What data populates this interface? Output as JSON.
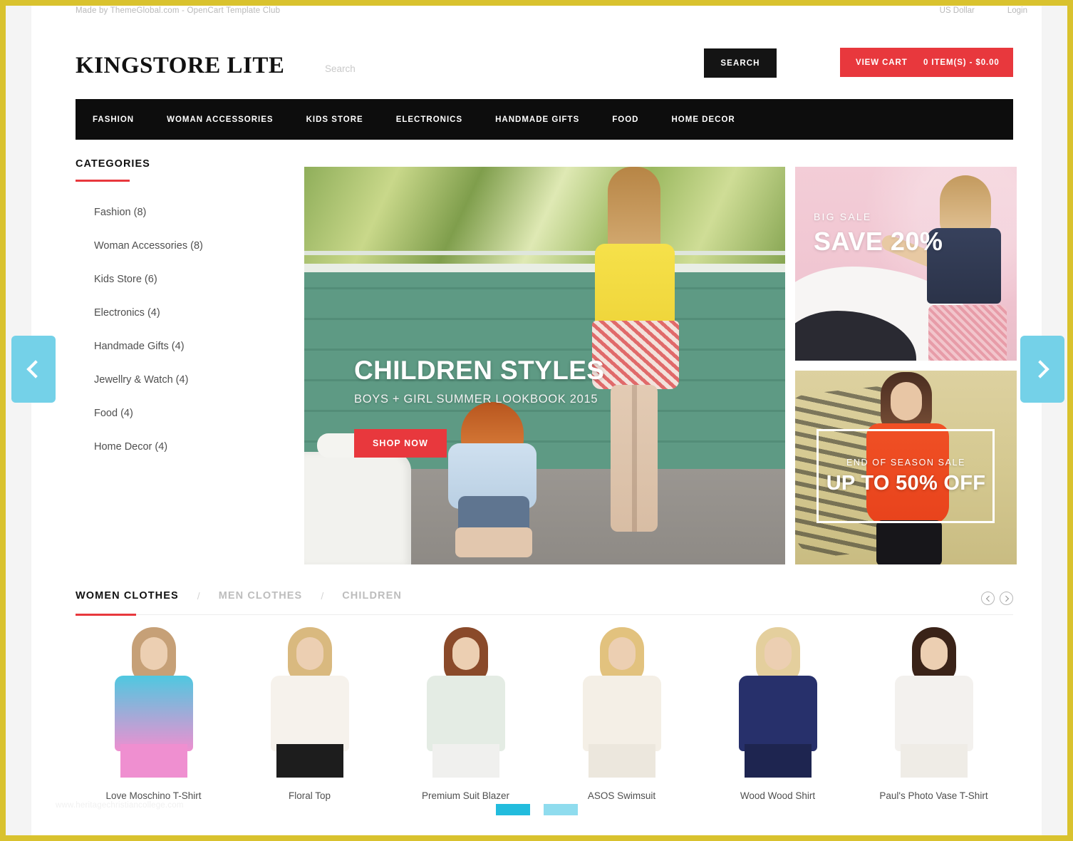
{
  "topbar": {
    "credit": "Made by ThemeGlobal.com - OpenCart Template Club",
    "currency": "US Dollar",
    "login": "Login"
  },
  "header": {
    "logo": "KINGSTORE LITE",
    "search_placeholder": "Search",
    "search_value": "",
    "search_button": "SEARCH",
    "cart_label": "VIEW CART",
    "cart_total": "0 ITEM(S) - $0.00"
  },
  "nav": {
    "items": [
      {
        "label": "FASHION"
      },
      {
        "label": "WOMAN ACCESSORIES"
      },
      {
        "label": "KIDS STORE"
      },
      {
        "label": "ELECTRONICS"
      },
      {
        "label": "HANDMADE GIFTS"
      },
      {
        "label": "FOOD"
      },
      {
        "label": "HOME DECOR"
      }
    ]
  },
  "sidebar": {
    "title": "CATEGORIES",
    "items": [
      {
        "label": "Fashion (8)"
      },
      {
        "label": "Woman Accessories (8)"
      },
      {
        "label": "Kids Store (6)"
      },
      {
        "label": "Electronics (4)"
      },
      {
        "label": "Handmade Gifts (4)"
      },
      {
        "label": "Jewellry & Watch (4)"
      },
      {
        "label": "Food (4)"
      },
      {
        "label": "Home Decor (4)"
      }
    ]
  },
  "hero": {
    "title": "CHILDREN STYLES",
    "subtitle": "BOYS + GIRL SUMMER LOOKBOOK 2015",
    "cta": "SHOP NOW"
  },
  "promos": [
    {
      "label": "BIG SALE",
      "headline": "SAVE 20%",
      "background_color": "#f0c9d4"
    },
    {
      "label": "END OF SEASON SALE",
      "headline": "UP TO 50% OFF",
      "background_color": "#cfc391"
    }
  ],
  "products_section": {
    "tabs": [
      {
        "label": "WOMEN CLOTHES",
        "active": true
      },
      {
        "label": "MEN CLOTHES",
        "active": false
      },
      {
        "label": "CHILDREN",
        "active": false
      }
    ],
    "separator": "/",
    "items": [
      {
        "name": "Love Moschino T-Shirt",
        "hair": "#c6a077",
        "body": "#4fc8e0",
        "bottom": "#ef8fd0"
      },
      {
        "name": "Floral Top",
        "hair": "#d9b97f",
        "body": "#f6f2ec",
        "bottom": "#1d1d1d"
      },
      {
        "name": "Premium Suit Blazer",
        "hair": "#8a4a2a",
        "body": "#e4ece4",
        "bottom": "#f0f0ee"
      },
      {
        "name": "ASOS Swimsuit",
        "hair": "#e2c27e",
        "body": "#f4efe6",
        "bottom": "#ece7dd"
      },
      {
        "name": "Wood Wood Shirt",
        "hair": "#e4cf9d",
        "body": "#27306b",
        "bottom": "#1e2550"
      },
      {
        "name": "Paul's Photo Vase T-Shirt",
        "hair": "#3a2318",
        "body": "#f3f1ee",
        "bottom": "#efece6"
      }
    ]
  },
  "slider": {
    "dots": [
      {
        "state": "active"
      },
      {
        "state": "inactive"
      }
    ]
  },
  "watermark": "www.heritagechristiancollege.com",
  "colors": {
    "accent_red": "#e8383d",
    "frame_yellow": "#d9c22e",
    "arrow_blue": "#74d1e8",
    "dot_active": "#22bcdd",
    "dot_inactive": "#8fdcee",
    "nav_black": "#0d0d0d"
  }
}
